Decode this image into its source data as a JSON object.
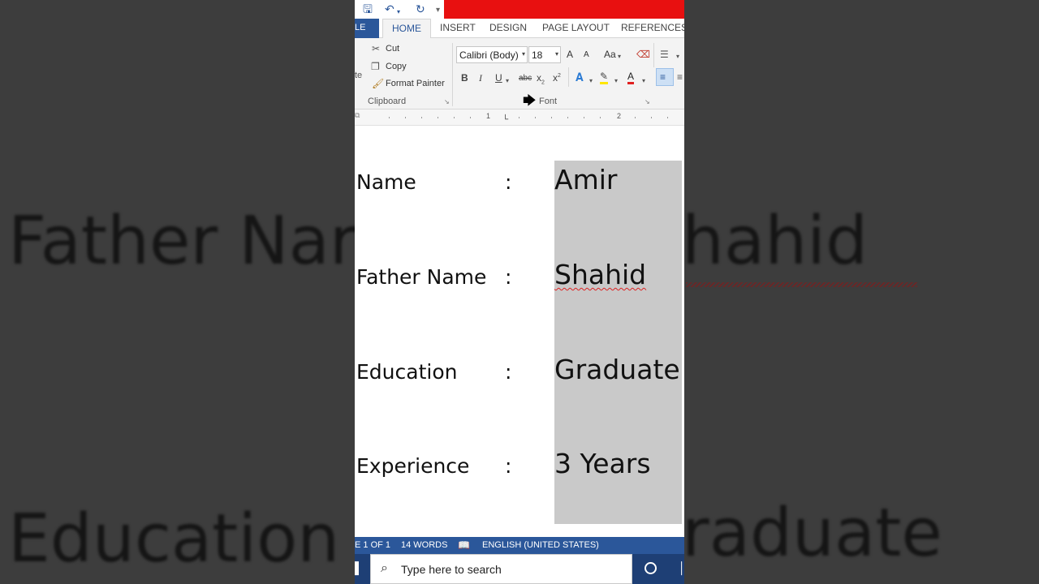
{
  "background": {
    "left_texts": [
      "Father Nar",
      "Education"
    ],
    "right_texts": [
      "hahid",
      "raduate"
    ]
  },
  "quick_access": {
    "save_icon": "save-icon",
    "undo_icon": "undo-icon",
    "redo_icon": "redo-icon",
    "customize_icon": "dropdown-icon"
  },
  "tabs": {
    "file": "LE",
    "home": "HOME",
    "insert": "INSERT",
    "design": "DESIGN",
    "page_layout": "PAGE LAYOUT",
    "references": "REFERENCES"
  },
  "clipboard": {
    "paste_partial": "te",
    "cut": "Cut",
    "copy": "Copy",
    "format_painter": "Format Painter",
    "label": "Clipboard"
  },
  "font": {
    "name": "Calibri (Body)",
    "size": "18",
    "grow": "A",
    "shrink": "A",
    "change_case": "Aa",
    "bold": "B",
    "italic": "I",
    "underline": "U",
    "strikethrough": "abc",
    "subscript": "x",
    "superscript": "x",
    "label": "Font"
  },
  "ruler": {
    "marks": [
      "1",
      "2"
    ]
  },
  "document": {
    "rows": [
      {
        "label": "Name",
        "colon": ":",
        "value": "Amir"
      },
      {
        "label": "Father Name",
        "colon": ":",
        "value": "Shahid"
      },
      {
        "label": "Education",
        "colon": ":",
        "value": "Graduate"
      },
      {
        "label": "Experience",
        "colon": ":",
        "value": "3 Years"
      }
    ]
  },
  "status": {
    "page": "E 1 OF 1",
    "words": "14 WORDS",
    "language": "ENGLISH (UNITED STATES)"
  },
  "taskbar": {
    "search_placeholder": "Type here to search"
  },
  "colors": {
    "accent": "#2b579a",
    "title_red": "#e81010",
    "highlight": "#c9c9c9"
  }
}
